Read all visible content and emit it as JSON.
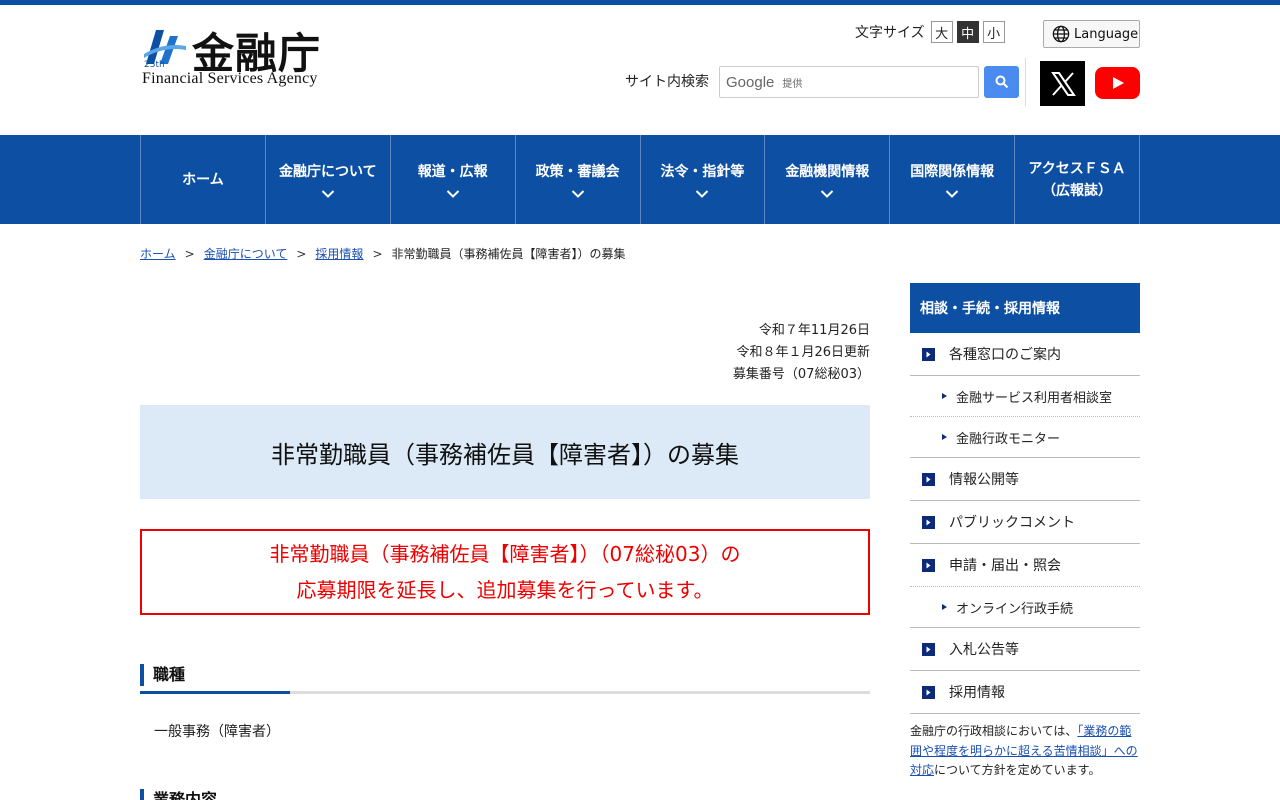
{
  "header": {
    "logo_title": "金融庁",
    "logo_subtitle": "Financial Services Agency",
    "logo_badge": "25th",
    "font_size_label": "文字サイズ",
    "font_sizes": [
      "大",
      "中",
      "小"
    ],
    "font_size_active": "中",
    "language_label": "Language",
    "search_label": "サイト内検索",
    "search_placeholder_brand": "Google",
    "search_placeholder_suffix": "提供",
    "colors": {
      "brand_blue": "#0d4fa3",
      "search_blue": "#4a8bf0",
      "youtube_red": "#ff0000"
    }
  },
  "nav": {
    "items": [
      {
        "label": "ホーム",
        "has_dropdown": false
      },
      {
        "label": "金融庁について",
        "has_dropdown": true
      },
      {
        "label": "報道・広報",
        "has_dropdown": true
      },
      {
        "label": "政策・審議会",
        "has_dropdown": true
      },
      {
        "label": "法令・指針等",
        "has_dropdown": true
      },
      {
        "label": "金融機関情報",
        "has_dropdown": true
      },
      {
        "label": "国際関係情報",
        "has_dropdown": true
      },
      {
        "label_line1": "アクセスＦＳＡ",
        "label_line2": "（広報誌）",
        "has_dropdown": false
      }
    ]
  },
  "breadcrumb": {
    "items": [
      "ホーム",
      "金融庁について",
      "採用情報"
    ],
    "separator": ">",
    "current": "非常勤職員（事務補佐員【障害者】）の募集"
  },
  "main": {
    "date_posted": "令和７年11月26日",
    "date_updated": "令和８年１月26日更新",
    "recruit_number": "募集番号（07総秘03）",
    "title": "非常勤職員（事務補佐員【障害者】）の募集",
    "notice_line1": "非常勤職員（事務補佐員【障害者】）（07総秘03）の",
    "notice_line2": "応募期限を延長し、追加募集を行っています。",
    "sections": [
      {
        "heading": "職種",
        "text": "一般事務（障害者）"
      },
      {
        "heading": "業務内容"
      }
    ]
  },
  "sidebar": {
    "heading": "相談・手続・採用情報",
    "items": [
      {
        "label": "各種窓口のご案内",
        "level": "main"
      },
      {
        "label": "金融サービス利用者相談室",
        "level": "sub"
      },
      {
        "label": "金融行政モニター",
        "level": "sub"
      },
      {
        "label": "情報公開等",
        "level": "main"
      },
      {
        "label": "パブリックコメント",
        "level": "main"
      },
      {
        "label": "申請・届出・照会",
        "level": "main"
      },
      {
        "label": "オンライン行政手続",
        "level": "sub"
      },
      {
        "label": "入札公告等",
        "level": "main"
      },
      {
        "label": "採用情報",
        "level": "main"
      }
    ],
    "note_prefix": "金融庁の行政相談においては、",
    "note_link": "「業務の範囲や程度を明らかに超える苦情相談」への対応",
    "note_suffix": "について方針を定めています。"
  }
}
